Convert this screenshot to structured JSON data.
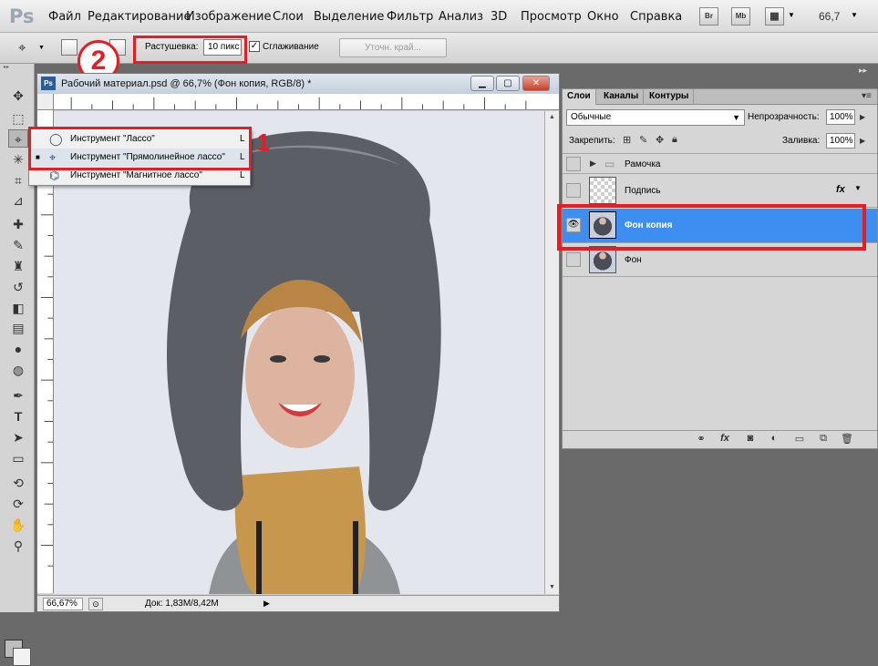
{
  "app": {
    "logo": "Ps",
    "zoom_readout": "66,7"
  },
  "menu": [
    "Файл",
    "Редактирование",
    "Изображение",
    "Слои",
    "Выделение",
    "Фильтр",
    "Анализ",
    "3D",
    "Просмотр",
    "Окно",
    "Справка"
  ],
  "app_buttons": [
    "Br",
    "Mb"
  ],
  "options": {
    "feather_label": "Растушевка:",
    "feather_value": "10 пикс",
    "antialias_label": "Сглаживание",
    "antialias_checked": "✓",
    "refine_edge": "Уточн. край..."
  },
  "annotations": {
    "one": "1",
    "two": "2"
  },
  "document": {
    "icon": "Ps",
    "title": "Рабочий материал.psd @ 66,7% (Фон копия, RGB/8) *",
    "minimize": "▁",
    "maximize": "▢",
    "close": "✕",
    "zoom": "66,67%",
    "doc_size": "Док: 1,83M/8,42M",
    "status_arrow": "▶"
  },
  "flyout": {
    "items": [
      {
        "label": "Инструмент \"Лассо\"",
        "key": "L",
        "mark": "",
        "icon": "lasso-icon"
      },
      {
        "label": "Инструмент \"Прямолинейное лассо\"",
        "key": "L",
        "mark": "■",
        "icon": "polygonal-lasso-icon"
      },
      {
        "label": "Инструмент \"Магнитное лассо\"",
        "key": "L",
        "mark": "",
        "icon": "magnetic-lasso-icon"
      }
    ]
  },
  "layers_panel": {
    "tabs": [
      "Слои",
      "Каналы",
      "Контуры"
    ],
    "blend_mode": "Обычные",
    "opacity_label": "Непрозрачность:",
    "opacity_value": "100%",
    "lock_label": "Закрепить:",
    "fill_label": "Заливка:",
    "fill_value": "100%",
    "layers": [
      {
        "name": "Рамочка",
        "type": "group",
        "visible": false
      },
      {
        "name": "Подпись",
        "type": "text",
        "visible": false,
        "fx": "fx"
      },
      {
        "name": "Фон копия",
        "type": "photo",
        "visible": true,
        "active": true
      },
      {
        "name": "Фон",
        "type": "photo",
        "visible": false
      }
    ]
  },
  "colors": {
    "accent_red": "#e51e26",
    "selection_blue": "#3c8ff0"
  }
}
